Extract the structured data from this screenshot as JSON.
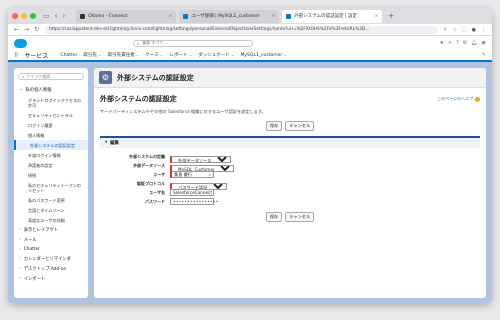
{
  "browser": {
    "tabs": [
      {
        "label": "Ollama - Connect",
        "active": false
      },
      {
        "label": "ユーザ詳細 | MySQL1_customer",
        "active": false
      },
      {
        "label": "外部システムの認証設定 | 設定",
        "active": true
      }
    ],
    "url": "https://caciappatent-dev-ed.lightning.force.com/lightning/settings/personal/ExternalObjectUserSettings/home?url=%2FXtOHS%2Fe%3FretURL%3D..."
  },
  "sf": {
    "search_placeholder": "検索 すべて...",
    "app_name": "サービス",
    "nav": [
      {
        "label": "Chatter",
        "chevron": false
      },
      {
        "label": "取引先",
        "chevron": true
      },
      {
        "label": "取引先責任者",
        "chevron": true
      },
      {
        "label": "ケース",
        "chevron": true
      },
      {
        "label": "レポート",
        "chevron": true
      },
      {
        "label": "ダッシュボード",
        "chevron": true
      },
      {
        "label": "MySQL1_customer",
        "chevron": true
      }
    ]
  },
  "sidebar": {
    "quickfind_placeholder": "クイック検索",
    "section_personal": "私の個人情報",
    "items": [
      "グラントログイングクセスの許可",
      "セキュリティセントラル",
      "ログイン履歴",
      "個人情報",
      "外部システムの認証設定",
      "外部ログイン情報",
      "承認者の設定",
      "接続",
      "私のセキュリティトークンのリセット",
      "私のパスワード変更",
      "言語とタイムゾーン",
      "高度なユーザの詳細"
    ],
    "sections": [
      "表示とレイアウト",
      "メール",
      "Chatter",
      "カレンダーとリマインダ",
      "デスクトップ Add-on",
      "インポート"
    ]
  },
  "page": {
    "header_title": "外部システムの認証設定",
    "heading": "外部システムの認証設定",
    "help_link": "このページのヘルプ",
    "description": "サードパーティシステムやその他の Salesforce 組織に対するユーザ認証を設定します。",
    "save_label": "保存",
    "cancel_label": "キャンセル",
    "block_title": "編集",
    "fields": {
      "ext_system_label": "外部システムの定義",
      "ext_system_value": "外部データソース",
      "ext_source_label": "外部データソース",
      "ext_source_value": "MySQL_Customer",
      "user_label": "ユーザ",
      "user_value": "桑島 慶行",
      "auth_label": "認証プロトコル",
      "auth_value": "パスワード認証",
      "username_label": "ユーザ名",
      "username_value": "SalesforceConnect",
      "password_label": "パスワード",
      "password_mask": "••••••••••••••••"
    }
  }
}
